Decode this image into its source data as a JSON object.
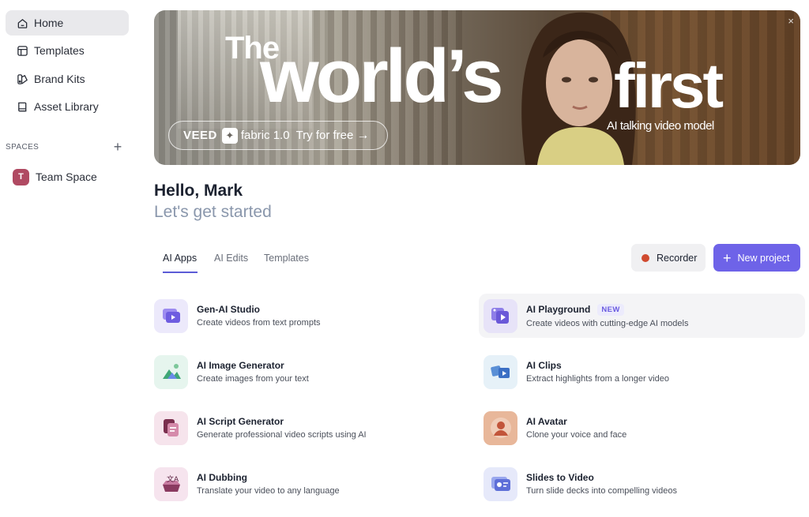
{
  "sidebar": {
    "items": [
      {
        "label": "Home",
        "icon": "home-icon"
      },
      {
        "label": "Templates",
        "icon": "templates-icon"
      },
      {
        "label": "Brand Kits",
        "icon": "brand-kits-icon"
      },
      {
        "label": "Asset Library",
        "icon": "asset-library-icon"
      }
    ],
    "spaces_label": "SPACES",
    "team": {
      "initial": "T",
      "name": "Team Space"
    }
  },
  "banner": {
    "headline_1": "The",
    "headline_2": "world’s",
    "headline_3": "first",
    "subline": "AI talking video model",
    "cta_brand": "VEED",
    "cta_product": "fabric 1.0",
    "cta_action": "Try for free",
    "close": "×"
  },
  "greeting": {
    "hello": "Hello, Mark",
    "subtitle": "Let's get started"
  },
  "tabs": [
    {
      "label": "AI Apps",
      "active": true
    },
    {
      "label": "AI Edits",
      "active": false
    },
    {
      "label": "Templates",
      "active": false
    }
  ],
  "actions": {
    "recorder": "Recorder",
    "new_project": "New project"
  },
  "apps": [
    {
      "title": "Gen-AI Studio",
      "desc": "Create videos from text prompts"
    },
    {
      "title": "AI Playground",
      "desc": "Create videos with cutting-edge AI models",
      "badge": "NEW"
    },
    {
      "title": "AI Image Generator",
      "desc": "Create images from your text"
    },
    {
      "title": "AI Clips",
      "desc": "Extract highlights from a longer video"
    },
    {
      "title": "AI Script Generator",
      "desc": "Generate professional video scripts using AI"
    },
    {
      "title": "AI Avatar",
      "desc": "Clone your voice and face"
    },
    {
      "title": "AI Dubbing",
      "desc": "Translate your video to any language"
    },
    {
      "title": "Slides to Video",
      "desc": "Turn slide decks into compelling videos"
    }
  ],
  "colors": {
    "accent": "#6e63e8",
    "recorder_dot": "#d04a2f",
    "subtitle": "#8a97ac"
  }
}
